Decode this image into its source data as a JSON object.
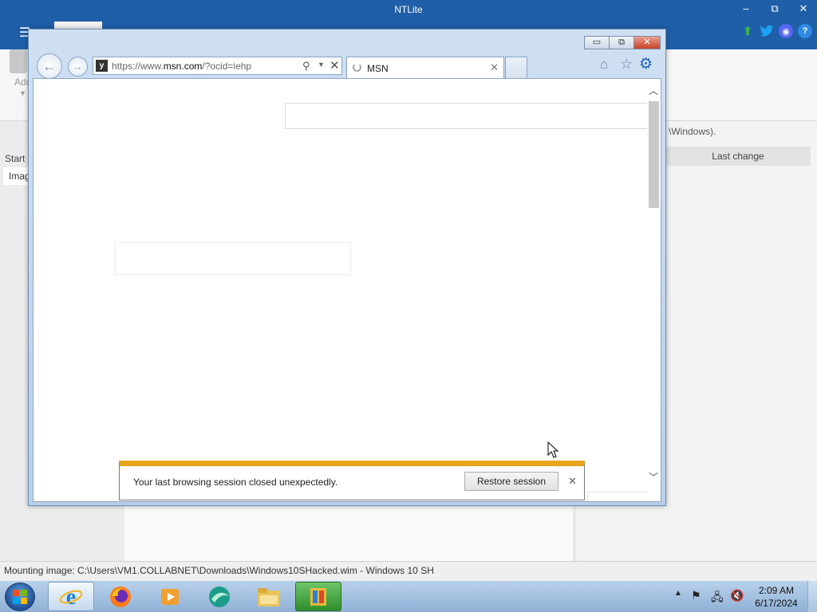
{
  "ntlite": {
    "title": "NTLite",
    "add_label": "Add",
    "start_label": "Start",
    "image_item_label": "Imag",
    "windows_text": "\\Windows).",
    "last_change_header": "Last change",
    "status_text": "Mounting image: C:\\Users\\VM1.COLLABNET\\Downloads\\Windows10SHacked.wim - Windows 10 SH",
    "window_buttons": {
      "minimize": "–",
      "restore": "⧉",
      "close": "✕"
    },
    "toolbar_icons": [
      "arrow-up-icon",
      "twitter-icon",
      "discord-icon",
      "help-icon"
    ]
  },
  "ie": {
    "url_prefix": "https://www.",
    "url_domain": "msn.com",
    "url_suffix": "/?ocid=iehp",
    "tab_label": "MSN",
    "notification_message": "Your last browsing session closed unexpectedly.",
    "restore_button": "Restore session",
    "accent_color": "#e6a51c"
  },
  "taskbar": {
    "time": "2:09 AM",
    "date": "6/17/2024",
    "apps": [
      "internet-explorer",
      "firefox",
      "media-player",
      "app-globe",
      "file-explorer",
      "ntlite"
    ]
  }
}
